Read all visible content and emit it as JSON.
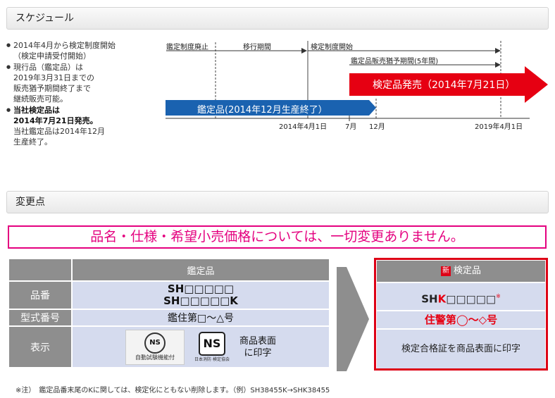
{
  "schedule": {
    "heading": "スケジュール",
    "bullets": [
      {
        "lines": [
          "2014年4月から検定制度開始",
          "（検定申請受付開始）"
        ],
        "bold": false
      },
      {
        "lines": [
          "現行品（鑑定品）は",
          "2019年3月31日までの",
          "販売猶予期間終了まで",
          "継続販売可能。"
        ],
        "bold": false
      },
      {
        "lines": [
          "当社検定品は",
          "2014年7月21日発売。"
        ],
        "bold": true,
        "extra": [
          "当社鑑定品は2014年12月",
          "生産終了。"
        ]
      }
    ],
    "timeline": {
      "phase_abolish": "鑑定制度廃止",
      "phase_transition": "移行期間",
      "phase_start": "検定制度開始",
      "phase_grace": "鑑定品販売猶予期間(5年間)",
      "bar_new": "検定品発売（2014年7月21日）",
      "bar_old": "鑑定品(2014年12月生産終了）",
      "ticks": [
        "2014年4月1日",
        "7月",
        "12月",
        "2019年4月1日"
      ],
      "color_new": "#e60012",
      "color_old": "#1a62b0"
    }
  },
  "changes": {
    "heading": "変更点",
    "notice": "品名・仕様・希望小売価格については、一切変更ありません。",
    "old": {
      "header": "鑑定品",
      "row_labels": [
        "品番",
        "型式番号",
        "表示"
      ],
      "part_numbers": [
        "SH□□□□□",
        "SH□□□□□K"
      ],
      "model_number": "鑑住第□〜△号",
      "ns_label_1": "NS",
      "ns_ring_text": "自動試験機能付",
      "ns_label_2": "NS",
      "ns_sub_text": "日本消防 検定協会",
      "print_text": [
        "商品表面",
        "に印字"
      ]
    },
    "new": {
      "badge": "新",
      "header": "検定品",
      "part_prefix": "SH",
      "part_highlight": "K",
      "part_suffix": "□□□□□",
      "part_note_mark": "※",
      "model_number": "住警第◯〜◇号",
      "display": "検定合格証を商品表面に印字"
    },
    "footnote": "※注）　鑑定品番末尾のKに関しては、検定化にともない削除します。（例）SH38455K→SHK38455"
  }
}
